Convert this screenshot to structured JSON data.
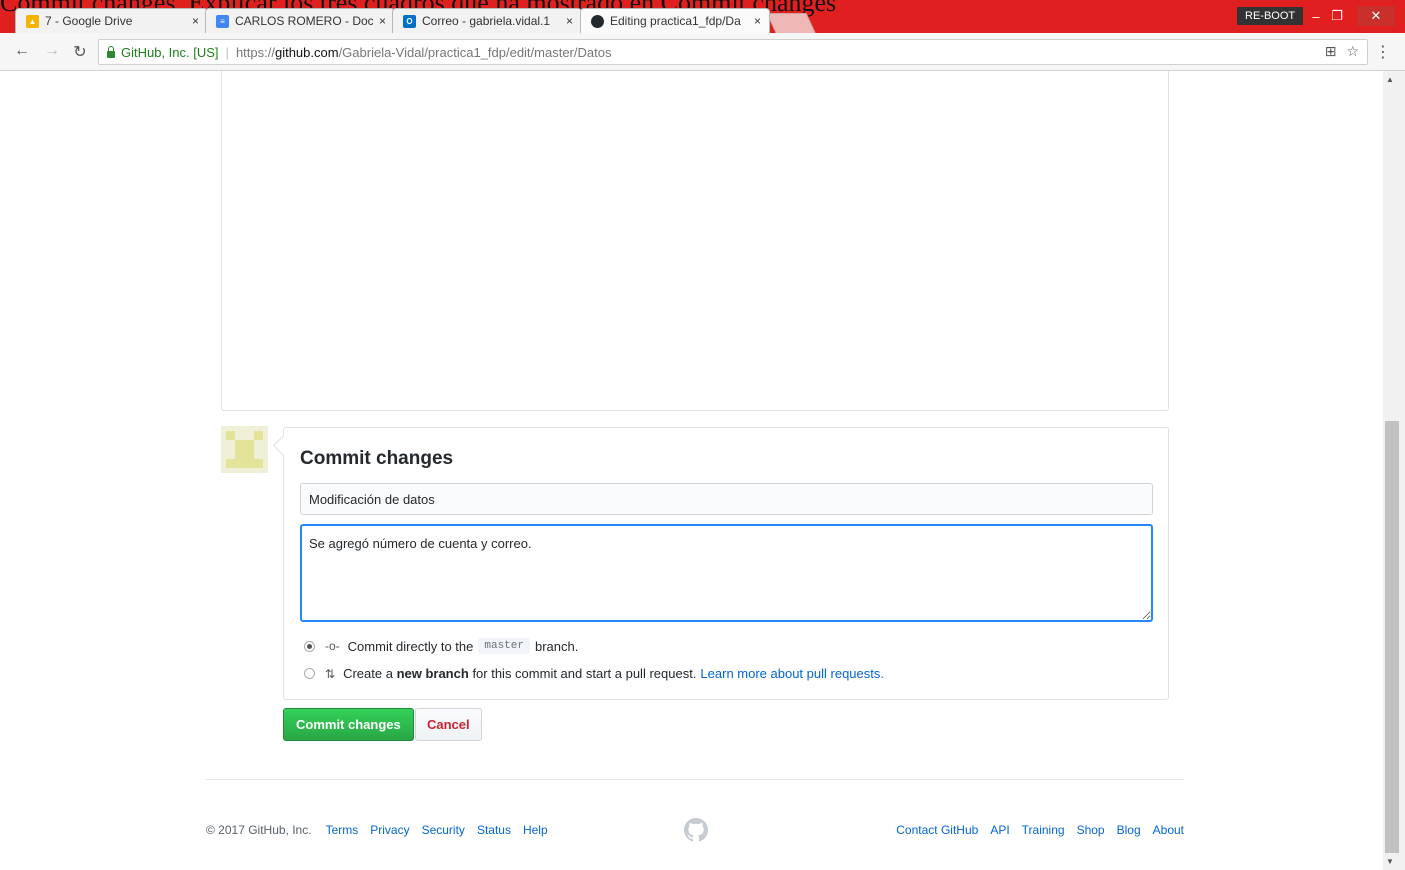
{
  "overlay_text": "Commit changes. Explicar los tres cuadros que ha mostrado en Commit changes",
  "browser": {
    "tabs": [
      {
        "title": "7 - Google Drive",
        "icon": "google-drive-icon",
        "close": "×"
      },
      {
        "title": "CARLOS ROMERO - Doc",
        "icon": "google-docs-icon",
        "close": "×"
      },
      {
        "title": "Correo - gabriela.vidal.1",
        "icon": "outlook-icon",
        "close": "×"
      },
      {
        "title": "Editing practica1_fdp/Da",
        "icon": "github-icon",
        "close": "×"
      }
    ],
    "reboot_label": "RE-BOOT",
    "secure_label": "GitHub, Inc. [US]",
    "url_proto": "https://",
    "url_host": "github.com",
    "url_path": "/Gabriela-Vidal/practica1_fdp/edit/master/Datos"
  },
  "commit": {
    "title": "Commit changes",
    "summary_value": "Modificación de datos",
    "description_value": "Se agregó número de cuenta y correo.",
    "option_direct": {
      "prefix": "Commit directly to the",
      "branch": "master",
      "suffix": "branch."
    },
    "option_new": {
      "prefix": "Create a",
      "bold": "new branch",
      "suffix": "for this commit and start a pull request.",
      "link": "Learn more about pull requests."
    },
    "submit_label": "Commit changes",
    "cancel_label": "Cancel"
  },
  "footer": {
    "copyright": "© 2017 GitHub, Inc.",
    "left_links": [
      "Terms",
      "Privacy",
      "Security",
      "Status",
      "Help"
    ],
    "right_links": [
      "Contact GitHub",
      "API",
      "Training",
      "Shop",
      "Blog",
      "About"
    ]
  },
  "colors": {
    "accent": "#e0201f",
    "primary_button": "#28a745",
    "link": "#0366d6"
  }
}
